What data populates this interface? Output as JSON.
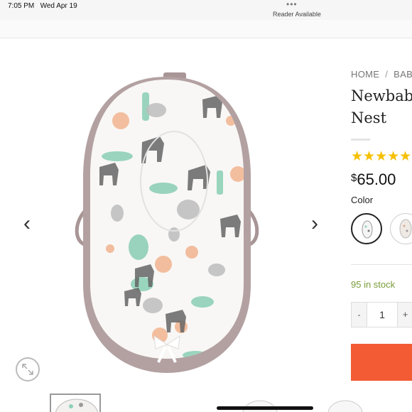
{
  "status_bar": {
    "time": "7:05 PM",
    "date": "Wed Apr 19",
    "dots": "•••",
    "reader": "Reader Available"
  },
  "gallery": {
    "prev_icon": "chevron-left-icon",
    "next_icon": "chevron-right-icon",
    "prev_glyph": "‹",
    "next_glyph": "›",
    "zoom_icon": "expand-icon"
  },
  "product": {
    "breadcrumb": [
      "HOME",
      "BABY"
    ],
    "breadcrumb_sep": "/",
    "title_line1": "Newbaby",
    "title_line2": "Nest",
    "rating_stars": "★★★★★",
    "rating": 5,
    "currency": "$",
    "price": "65.00",
    "color_label": "Color",
    "stock": "95 in stock",
    "quantity": "1",
    "minus": "-",
    "plus": "+"
  },
  "colors": {
    "accent": "#f25b34",
    "stars": "#f5c000",
    "stock": "#7a9c3a"
  }
}
